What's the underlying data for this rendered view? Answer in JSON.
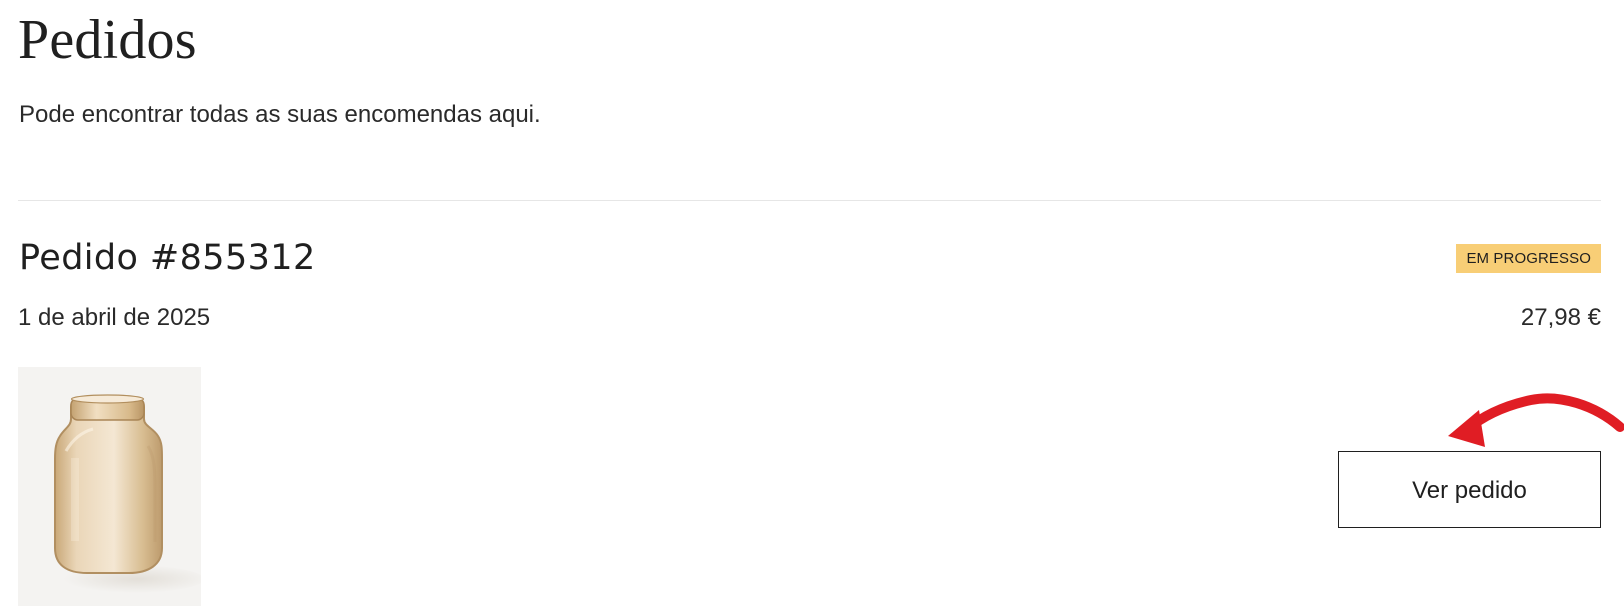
{
  "page": {
    "title": "Pedidos",
    "subtitle": "Pode encontrar todas as suas encomendas aqui."
  },
  "order": {
    "title": "Pedido #855312",
    "status": "EM PROGRESSO",
    "date": "1 de abril de 2025",
    "total": "27,98 €",
    "product_image": "amber-glass-vase",
    "view_button_label": "Ver pedido"
  },
  "colors": {
    "status_badge": "#f8ce76",
    "annotation_arrow": "#e01d24",
    "divider": "#e6e6e6"
  },
  "annotation": {
    "icon": "red-curved-arrow-icon",
    "target": "view-order-button"
  }
}
